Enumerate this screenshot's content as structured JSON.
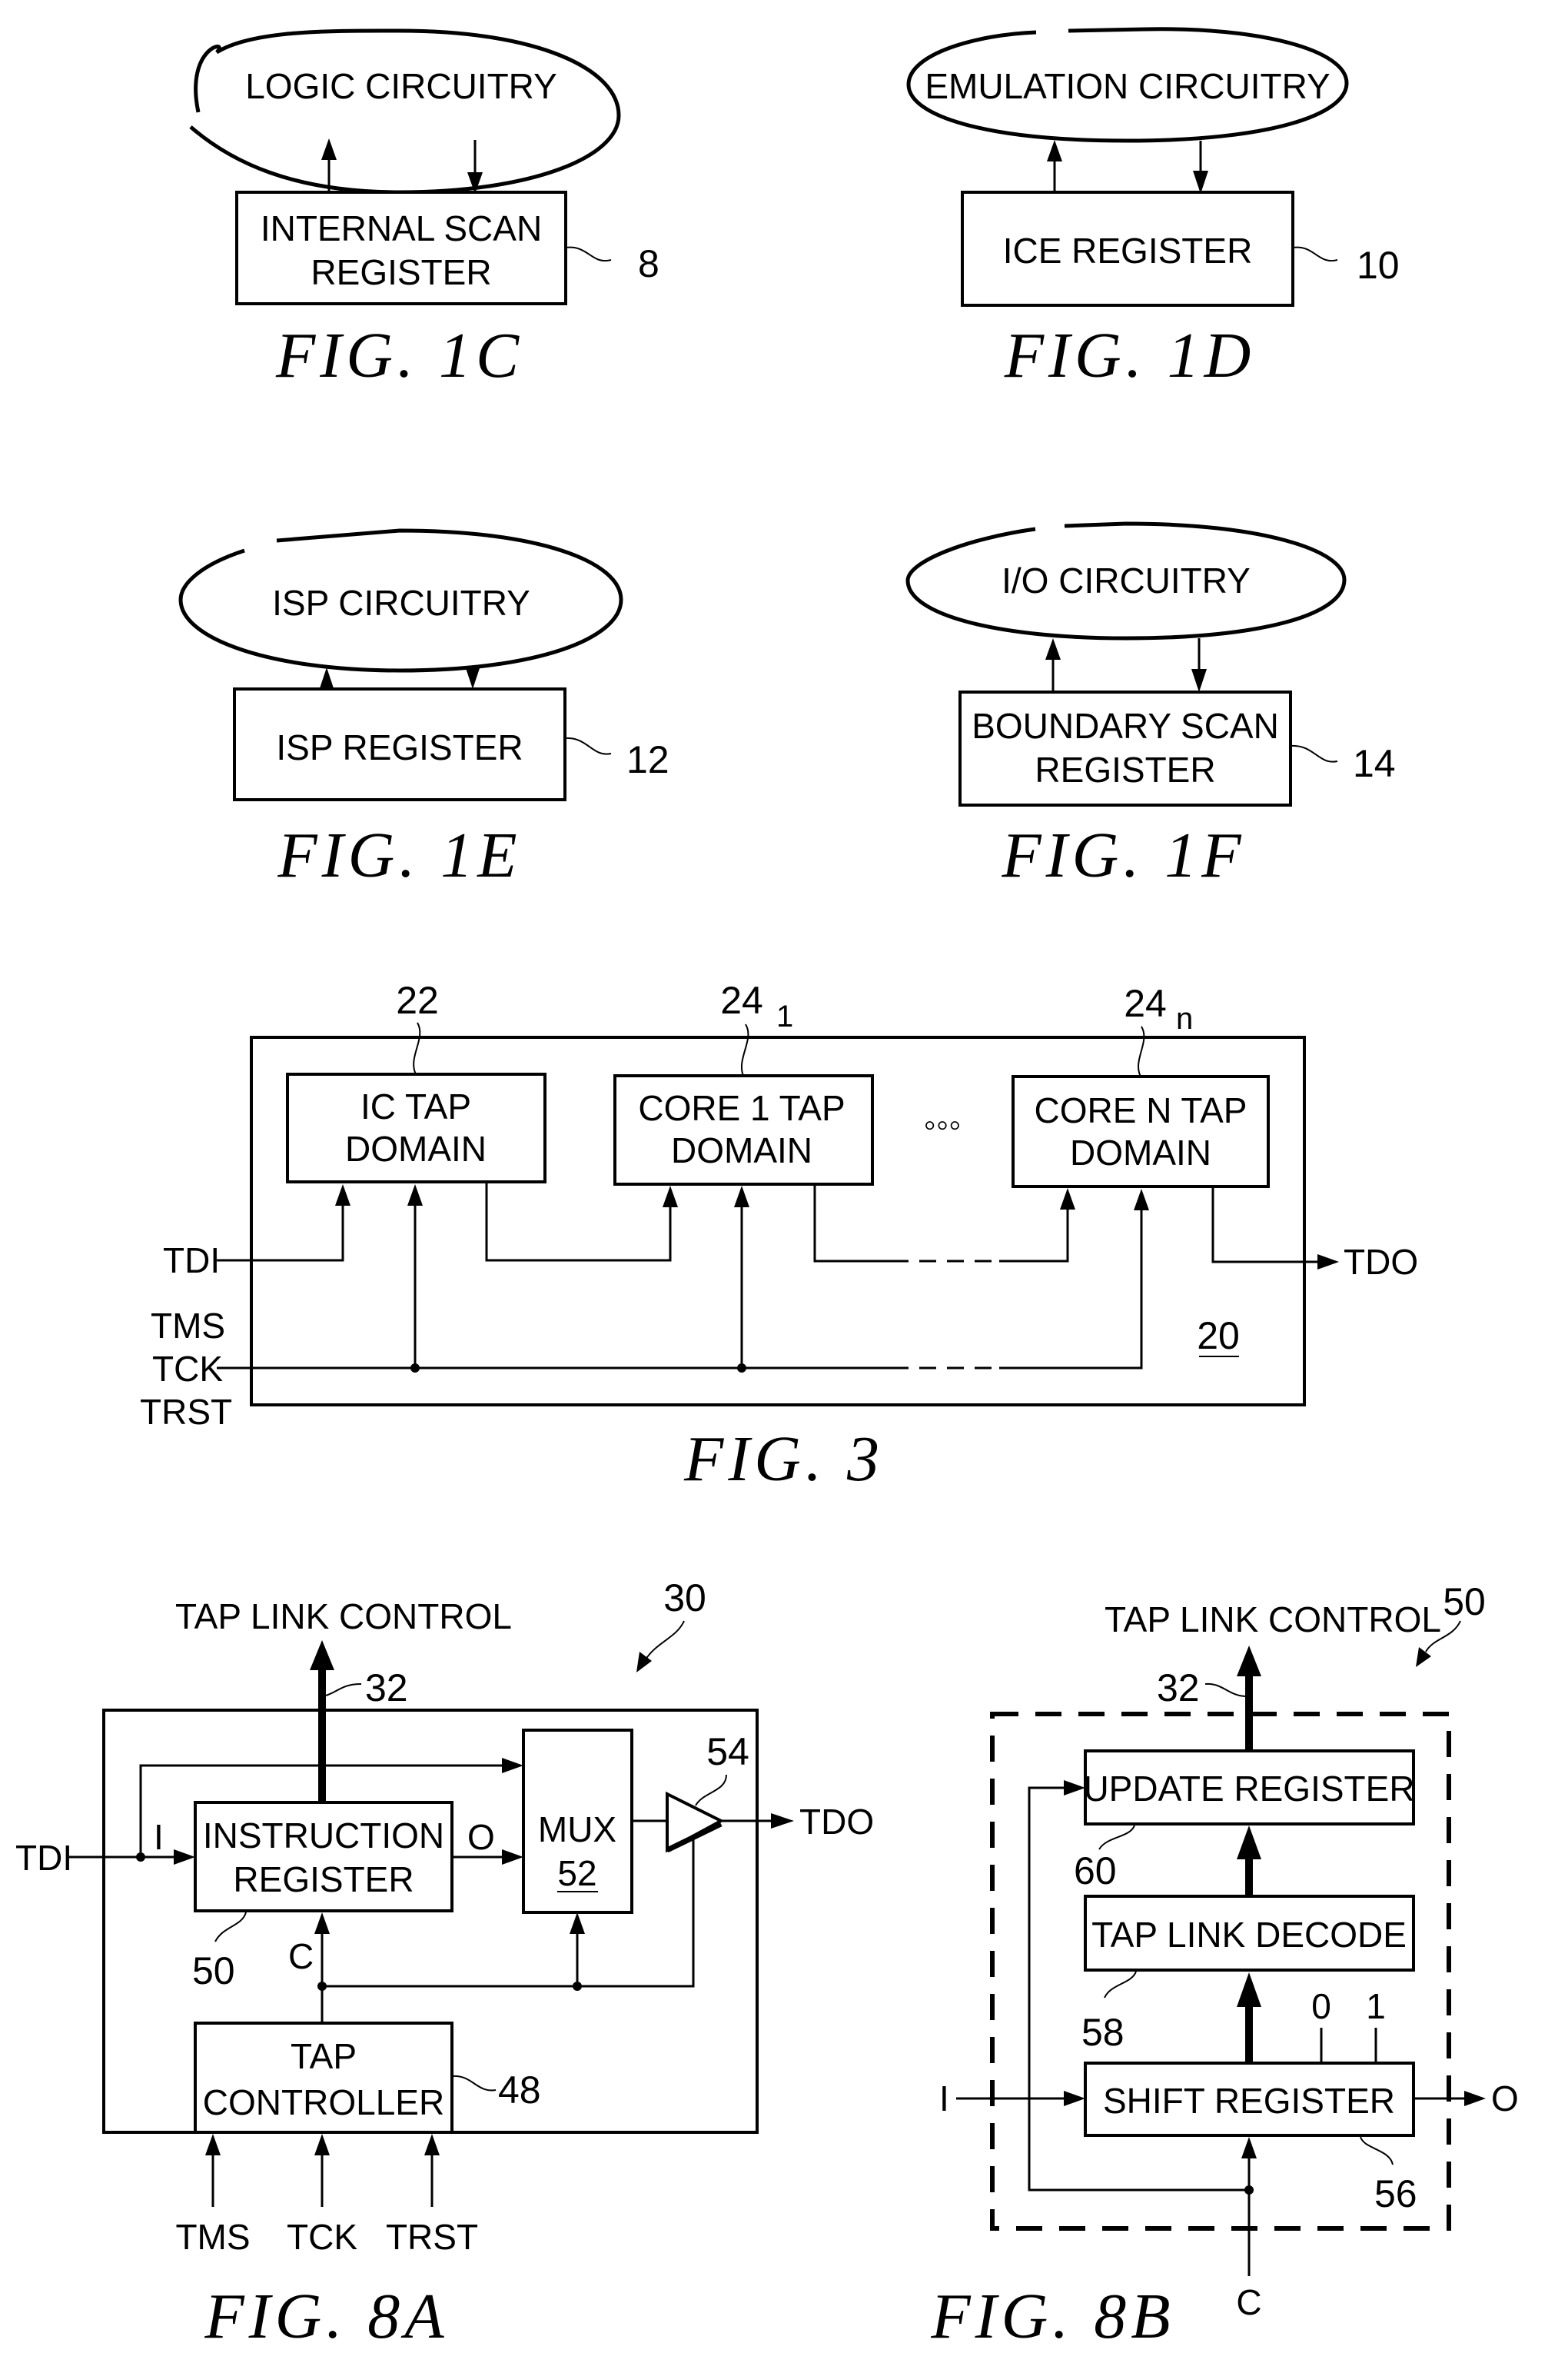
{
  "page": {
    "type": "patent drawing sheet",
    "background": "#ffffff",
    "ink": "#000000"
  },
  "fig1c": {
    "caption": "FIG. 1C",
    "cloud_label": "LOGIC CIRCUITRY",
    "box_lines": [
      "INTERNAL SCAN",
      "REGISTER"
    ],
    "ref": "8"
  },
  "fig1d": {
    "caption": "FIG. 1D",
    "cloud_label": "EMULATION CIRCUITRY",
    "box_lines": [
      "ICE REGISTER"
    ],
    "ref": "10"
  },
  "fig1e": {
    "caption": "FIG. 1E",
    "cloud_label": "ISP CIRCUITRY",
    "box_lines": [
      "ISP REGISTER"
    ],
    "ref": "12"
  },
  "fig1f": {
    "caption": "FIG. 1F",
    "cloud_label": "I/O CIRCUITRY",
    "box_lines": [
      "BOUNDARY SCAN",
      "REGISTER"
    ],
    "ref": "14"
  },
  "fig3": {
    "caption": "FIG. 3",
    "chip_ref": "20",
    "domains": [
      {
        "lines": [
          "IC TAP",
          "DOMAIN"
        ],
        "ref": "22",
        "ref_sub": ""
      },
      {
        "lines": [
          "CORE 1 TAP",
          "DOMAIN"
        ],
        "ref": "24",
        "ref_sub": "1"
      },
      {
        "lines": [
          "CORE N TAP",
          "DOMAIN"
        ],
        "ref": "24",
        "ref_sub": "n"
      }
    ],
    "ellipsis": "◦◦◦",
    "inputs": [
      "TDI",
      "TMS",
      "TCK",
      "TRST"
    ],
    "output": "TDO"
  },
  "fig8a": {
    "caption": "FIG. 8A",
    "ref": "30",
    "top_label": "TAP LINK CONTROL",
    "bus_ref": "32",
    "instruction_register": {
      "lines": [
        "INSTRUCTION",
        "REGISTER"
      ],
      "ref": "50"
    },
    "mux": {
      "label": "MUX",
      "ref": "52"
    },
    "buffer_ref": "54",
    "tap_controller": {
      "lines": [
        "TAP",
        "CONTROLLER"
      ],
      "ref": "48"
    },
    "pin_labels": {
      "I": "I",
      "O": "O",
      "C": "C"
    },
    "inputs": [
      "TMS",
      "TCK",
      "TRST"
    ],
    "tdi": "TDI",
    "tdo": "TDO"
  },
  "fig8b": {
    "caption": "FIG. 8B",
    "ref": "50",
    "top_label": "TAP LINK CONTROL",
    "bus_ref": "32",
    "update_register": {
      "label": "UPDATE REGISTER",
      "ref": "60"
    },
    "decode": {
      "label": "TAP LINK DECODE",
      "ref": "58"
    },
    "shift_register": {
      "label": "SHIFT REGISTER",
      "ref": "56"
    },
    "bit_labels": [
      "0",
      "1"
    ],
    "input": "I",
    "output": "O",
    "clock": "C"
  }
}
